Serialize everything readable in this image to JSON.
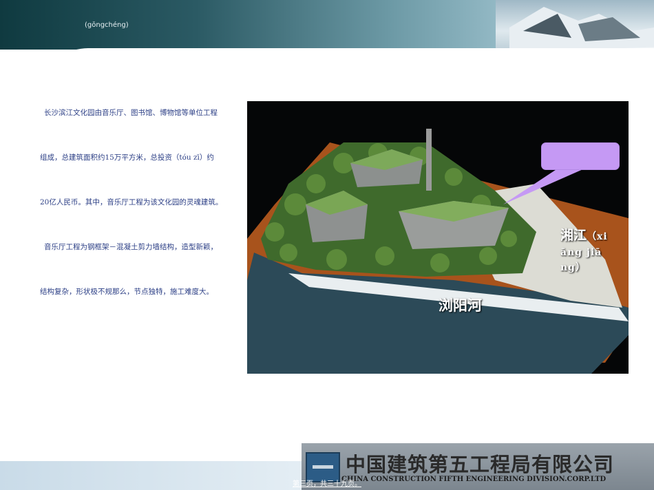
{
  "header": {
    "title": "(gōngchéng)"
  },
  "body_text": {
    "lines": [
      "长沙滨江文化园由音乐厅、图书馆、博物馆等单位工程",
      "组成，总建筑面积约15万平方米，总投资（tóu zī）约",
      "20亿人民币。其中，音乐厅工程为该文化园的灵魂建筑。",
      "音乐厅工程为钢框架－混凝土剪力墙结构，造型新颖，",
      "结构复杂，形状极不规那么，节点独特，施工难度大。"
    ]
  },
  "photo": {
    "label_xiangjiang": "湘江",
    "label_xiangjiang_pinyin_1": "（xi",
    "label_xiangjiang_pinyin_2": "āng jiā",
    "label_xiangjiang_pinyin_3": "ng）",
    "label_liuyanghe": "浏阳河"
  },
  "footer": {
    "logo_cn": "中国建筑第五工程局有限公司",
    "logo_en": "CHINA CONSTRUCTION FIFTH ENGINEERING DIVISION.CORP.LTD",
    "page_number": "第三页，共三十九页。"
  },
  "colors": {
    "body_text": "#2b3e85",
    "callout": "#c599f4",
    "header_dark": "#0f3a40"
  }
}
